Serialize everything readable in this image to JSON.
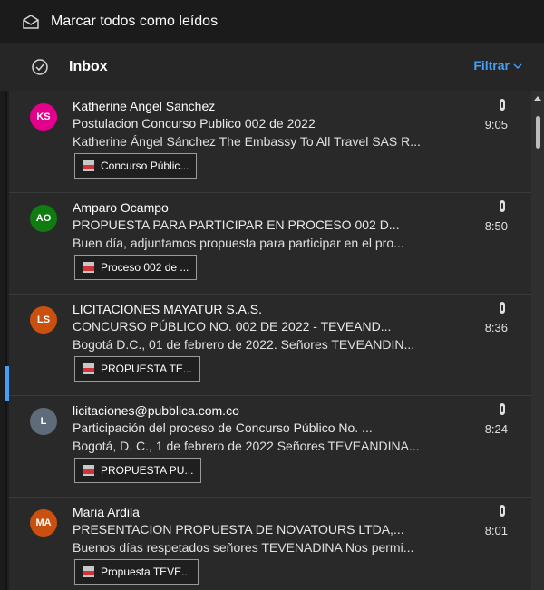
{
  "toolbar": {
    "mark_all_read": "Marcar todos como leídos",
    "icon": "envelope-open-icon"
  },
  "header": {
    "title": "Inbox",
    "filter_label": "Filtrar",
    "check_icon": "check-circle-icon"
  },
  "messages": [
    {
      "initials": "KS",
      "avatar_color": "#e3008c",
      "sender": "Katherine Angel Sanchez",
      "subject": "Postulacion Concurso Publico 002 de 2022",
      "time": "9:05",
      "preview": "Katherine Ángel Sánchez The Embassy To All Travel SAS R...",
      "attachment": "Concurso Públic..."
    },
    {
      "initials": "AO",
      "avatar_color": "#107c10",
      "sender": "Amparo Ocampo",
      "subject": "PROPUESTA PARA PARTICIPAR EN PROCESO 002 D...",
      "time": "8:50",
      "preview": "Buen día, adjuntamos propuesta para participar en el pro...",
      "attachment": "Proceso 002 de ..."
    },
    {
      "initials": "LS",
      "avatar_color": "#ca5010",
      "sender": "LICITACIONES MAYATUR S.A.S.",
      "subject": "CONCURSO PÚBLICO NO. 002 DE 2022 - TEVEAND...",
      "time": "8:36",
      "preview": "Bogotá D.C., 01 de febrero de 2022. Señores TEVEANDIN...",
      "attachment": "PROPUESTA TE..."
    },
    {
      "initials": "L",
      "avatar_color": "#5f6b7a",
      "sender": "licitaciones@pubblica.com.co",
      "subject": "Participación del proceso de Concurso Público No. ...",
      "time": "8:24",
      "preview": "Bogotá, D. C., 1 de febrero de 2022 Señores TEVEANDINA...",
      "attachment": "PROPUESTA PU..."
    },
    {
      "initials": "MA",
      "avatar_color": "#ca5010",
      "sender": "Maria Ardila",
      "subject": "PRESENTACION PROPUESTA DE NOVATOURS LTDA,...",
      "time": "8:01",
      "preview": "Buenos días respetados señores TEVENADINA Nos permi...",
      "attachment": "Propuesta TEVE..."
    }
  ]
}
